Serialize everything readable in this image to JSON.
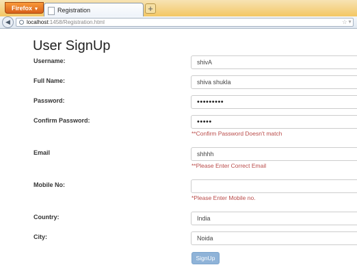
{
  "browser": {
    "app_button": "Firefox",
    "tab_title": "Registration",
    "new_tab": "+",
    "url_host": "localhost",
    "url_rest": ":1458/Registration.html"
  },
  "form": {
    "title": "User SignUp",
    "fields": {
      "username": {
        "label": "Username:",
        "value": "shivA"
      },
      "fullname": {
        "label": "Full Name:",
        "value": "shiva shukla"
      },
      "password": {
        "label": "Password:",
        "value": "•••••••••"
      },
      "confirm": {
        "label": "Confirm Password:",
        "value": "•••••",
        "error": "**Confirm Password Doesn't match"
      },
      "email": {
        "label": "Email",
        "value": "shhhh",
        "error": "**Please Enter Correct Email"
      },
      "mobile": {
        "label": "Mobile No:",
        "value": "",
        "error": "*Please Enter Mobile no."
      },
      "country": {
        "label": "Country:",
        "value": "India"
      },
      "city": {
        "label": "City:",
        "value": "Noida"
      }
    },
    "submit_label": "SignUp"
  }
}
